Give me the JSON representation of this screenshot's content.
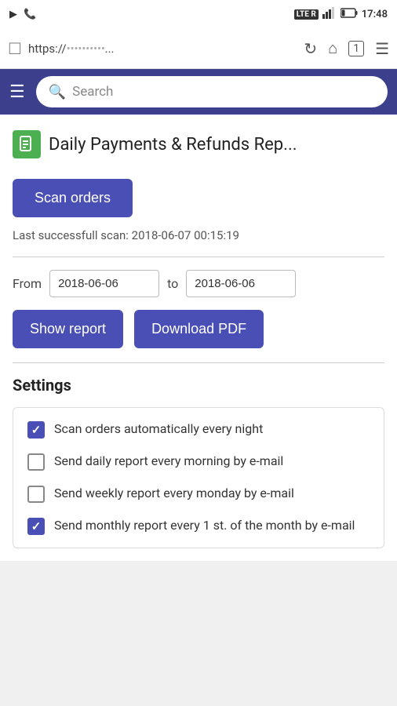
{
  "statusBar": {
    "lteLabel": "LTE R",
    "batteryPercent": "23%",
    "time": "17:48"
  },
  "browserBar": {
    "urlPrefix": "https://",
    "urlObfuscated": "••••••••••",
    "urlSuffix": "..."
  },
  "appHeader": {
    "searchPlaceholder": "Search"
  },
  "pageTitle": "Daily Payments & Refunds Rep...",
  "scanOrdersButton": "Scan orders",
  "lastScan": {
    "label": "Last successfull scan:",
    "value": "2018-06-07 00:15:19"
  },
  "dateRange": {
    "fromLabel": "From",
    "fromValue": "2018-06-06",
    "toLabel": "to",
    "toValue": "2018-06-06"
  },
  "showReportButton": "Show report",
  "downloadPdfButton": "Download PDF",
  "settings": {
    "title": "Settings",
    "items": [
      {
        "id": "scan-auto",
        "label": "Scan orders automatically every night",
        "checked": true
      },
      {
        "id": "send-daily",
        "label": "Send daily report every morning by e-mail",
        "checked": false
      },
      {
        "id": "send-weekly",
        "label": "Send weekly report every monday by e-mail",
        "checked": false
      },
      {
        "id": "send-monthly",
        "label": "Send monthly report every 1 st. of the month by e-mail",
        "checked": true
      }
    ]
  }
}
